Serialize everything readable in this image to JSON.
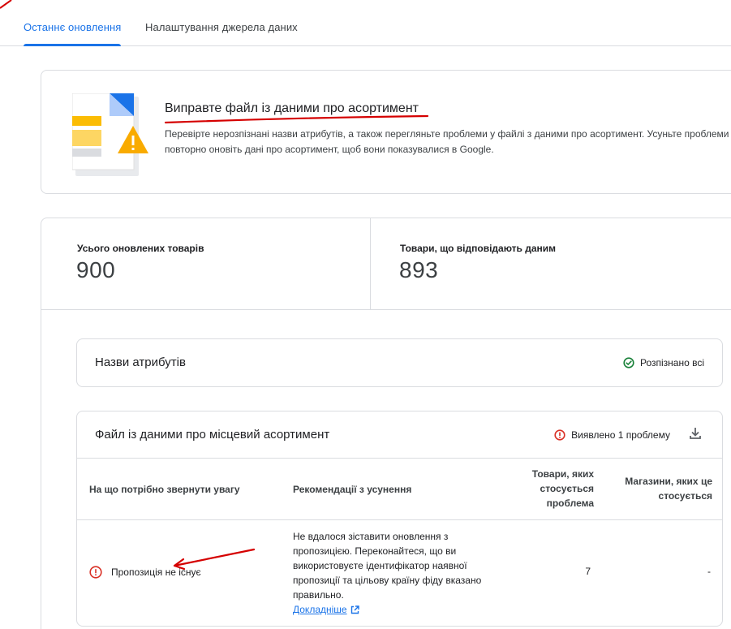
{
  "tabs": {
    "active_label": "Останнє оновлення",
    "inactive_label": "Налаштування джерела даних"
  },
  "alert": {
    "title": "Виправте файл із даними про асортимент",
    "description": "Перевірте нерозпізнані назви атрибутів, а також перегляньте проблеми у файлі з даними про асортимент. Усуньте проблеми й повторно оновіть дані про асортимент, щоб вони показувалися в Google.",
    "illustration_icon": "document-warning-icon"
  },
  "stats": {
    "total_label": "Усього оновлених товарів",
    "total_value": "900",
    "matched_label": "Товари, що відповідають даним",
    "matched_value": "893"
  },
  "attributes": {
    "title": "Назви атрибутів",
    "status": "Розпізнано всі",
    "status_icon": "check-circle-icon"
  },
  "file": {
    "title": "Файл із даними про місцевий асортимент",
    "status": "Виявлено 1 проблему",
    "status_icon": "error-icon",
    "download_icon": "download-icon",
    "columns": {
      "issue": "На що потрібно звернути увагу",
      "recommendation": "Рекомендації з усунення",
      "products": "Товари, яких стосується проблема",
      "stores": "Магазини, яких це стосується"
    },
    "rows": [
      {
        "issue": "Пропозиція не існує",
        "recommendation": "Не вдалося зіставити оновлення з пропозицією. Переконайтеся, що ви використовуєте ідентифікатор наявної пропозиції та цільову країну фіду вказано правильно.",
        "link": "Докладніше",
        "products": "7",
        "stores": "-"
      }
    ]
  },
  "colors": {
    "accent": "#1a73e8",
    "error": "#d93025",
    "success": "#188038",
    "annotation": "#d50000"
  }
}
